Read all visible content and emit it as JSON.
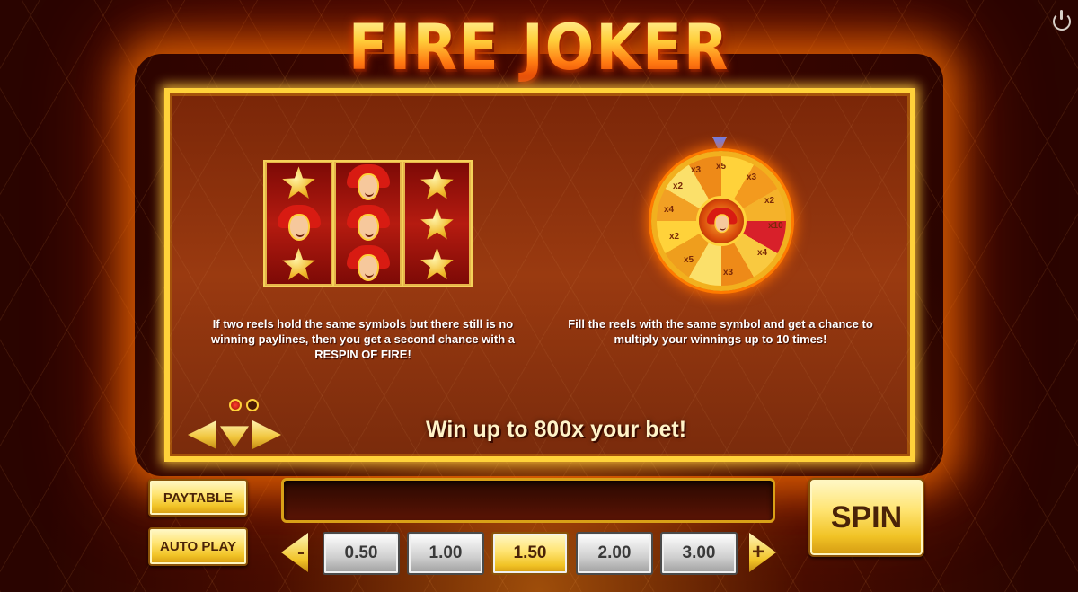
{
  "header": {
    "title": "FIRE JOKER"
  },
  "info_panel": {
    "left_description": "If two reels hold the same symbols but there still is no winning paylines, then you get a second chance with a RESPIN OF FIRE!",
    "right_description": "Fill the reels with the same symbol and get a chance to multiply your winnings up to 10 times!",
    "win_text": "Win up to 800x your bet!",
    "reels": [
      [
        "star",
        "joker",
        "star"
      ],
      [
        "joker",
        "joker",
        "joker"
      ],
      [
        "star",
        "star",
        "star"
      ]
    ],
    "wheel_multipliers": [
      "x5",
      "x3",
      "x2",
      "x10",
      "x4",
      "x3",
      "x5",
      "x2",
      "x4",
      "x2",
      "x3"
    ],
    "page_dots": [
      {
        "active": true
      },
      {
        "active": false
      }
    ]
  },
  "controls": {
    "paytable_label": "PAYTABLE",
    "autoplay_label": "AUTO PLAY",
    "spin_label": "SPIN",
    "bet_minus_label": "-",
    "bet_plus_label": "+",
    "bet_options": [
      "0.50",
      "1.00",
      "1.50",
      "2.00",
      "3.00"
    ],
    "selected_bet": "1.50"
  },
  "colors": {
    "gold": "#ffd23a",
    "panel_red": "#8a3010",
    "selected_bet": "#ffe472"
  }
}
